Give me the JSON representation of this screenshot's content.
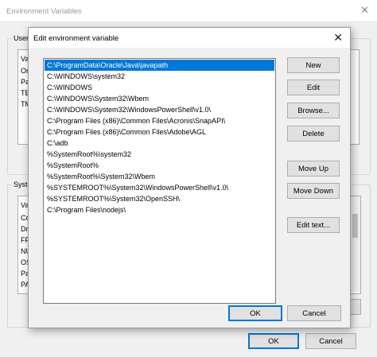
{
  "parent": {
    "title": "Environment Variables",
    "user_group_label": "User",
    "user_list_first_col": "Va",
    "user_rows": [
      "On",
      "Pa",
      "TE",
      "TM"
    ],
    "system_group_label": "Syste",
    "system_list_first_col": "Va",
    "system_rows": [
      "Co",
      "Dr",
      "FP",
      "NU",
      "OS",
      "Pa",
      "PA"
    ],
    "ok_label": "OK",
    "cancel_label": "Cancel"
  },
  "dialog": {
    "title": "Edit environment variable",
    "paths": [
      "C:\\ProgramData\\Oracle\\Java\\javapath",
      "C:\\WINDOWS\\system32",
      "C:\\WINDOWS",
      "C:\\WINDOWS\\System32\\Wbem",
      "C:\\WINDOWS\\System32\\WindowsPowerShell\\v1.0\\",
      "C:\\Program Files (x86)\\Common Files\\Acronis\\SnapAPI\\",
      "C:\\Program Files (x86)\\Common Files\\Adobe\\AGL",
      "C:\\adb",
      "%SystemRoot%\\system32",
      "%SystemRoot%",
      "%SystemRoot%\\System32\\Wbem",
      "%SYSTEMROOT%\\System32\\WindowsPowerShell\\v1.0\\",
      "%SYSTEMROOT%\\System32\\OpenSSH\\",
      "C:\\Program Files\\nodejs\\"
    ],
    "selected_index": 0,
    "buttons": {
      "new": "New",
      "edit": "Edit",
      "browse": "Browse...",
      "delete": "Delete",
      "move_up": "Move Up",
      "move_down": "Move Down",
      "edit_text": "Edit text..."
    },
    "ok_label": "OK",
    "cancel_label": "Cancel"
  },
  "colors": {
    "selection": "#0078d7",
    "button_face": "#e1e1e1",
    "window_bg": "#f0f0f0"
  }
}
